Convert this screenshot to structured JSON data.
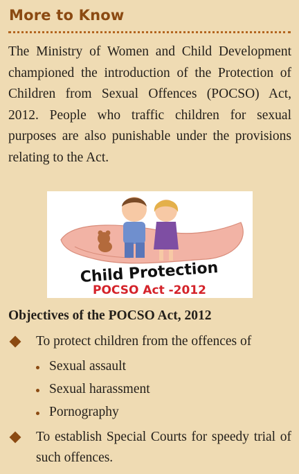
{
  "box": {
    "title": "More to Know",
    "paragraph": "The Ministry of Women and Child Development championed the introduction of the Protection of Children from Sexual Offences (POCSO) Act, 2012. People who traffic children for sexual purposes are also punishable under the provisions relating to the Act.",
    "illustration": {
      "line1": "Child Protection",
      "line2": "POCSO Act -2012"
    },
    "objectives_title": "Objectives of the POCSO Act, 2012",
    "bullets": [
      {
        "text": "To protect children from the offences of",
        "subitems": [
          "Sexual assault",
          "Sexual harassment",
          "Pornography"
        ]
      },
      {
        "text": "To establish Special Courts for speedy trial of such offences."
      }
    ]
  }
}
